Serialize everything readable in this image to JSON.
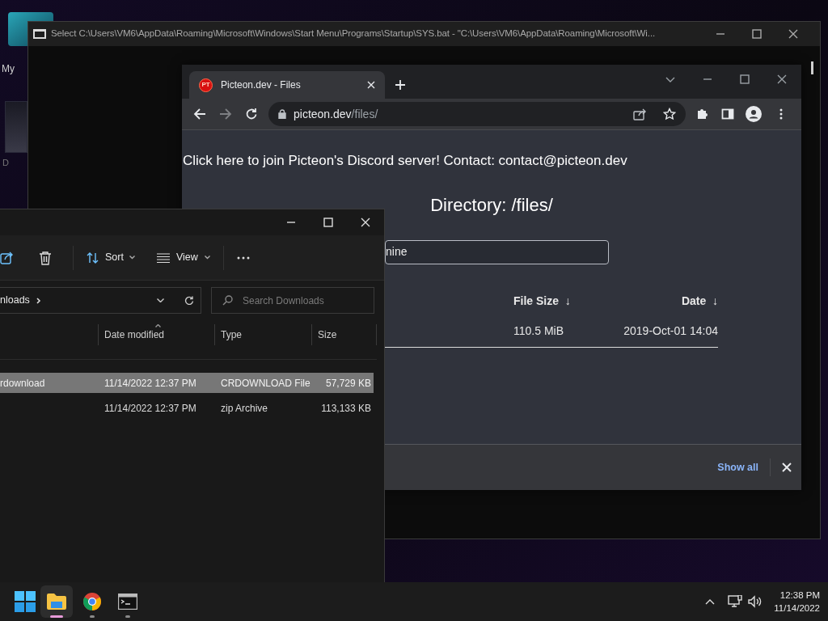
{
  "desktop": {
    "icons": [
      {
        "label": "My"
      },
      {
        "label": "D"
      }
    ]
  },
  "console_window": {
    "title": "Select C:\\Users\\VM6\\AppData\\Roaming\\Microsoft\\Windows\\Start Menu\\Programs\\Startup\\SYS.bat - \"C:\\Users\\VM6\\AppData\\Roaming\\Microsoft\\Wi..."
  },
  "browser": {
    "tabs": [
      {
        "title": "Picteon.dev - Files",
        "favicon_text": "PT",
        "selected": true
      }
    ],
    "address": {
      "host": "picteon.dev",
      "path": "/files/"
    },
    "page": {
      "notice": "Click here to join Picteon's Discord server! Contact: contact@picteon.dev",
      "heading": "Directory: /files/",
      "filter": {
        "value": "nine"
      },
      "table": {
        "columns": [
          {
            "label": "File Size",
            "sort_mark": "↓"
          },
          {
            "label": "Date",
            "sort_mark": "↓"
          }
        ],
        "rows": [
          {
            "cells": [
              "110.5 MiB",
              "2019-Oct-01 14:04"
            ]
          }
        ]
      }
    },
    "download_bar": {
      "show_all": "Show all"
    }
  },
  "explorer": {
    "toolbar": [
      {
        "kind": "share"
      },
      {
        "kind": "delete"
      },
      {
        "kind": "sort",
        "label": "Sort"
      },
      {
        "kind": "view",
        "label": "View"
      },
      {
        "kind": "more"
      }
    ],
    "address": "nloads",
    "search": {
      "placeholder": "Search Downloads"
    },
    "columns": [
      {
        "label": "Date modified"
      },
      {
        "label": "Type"
      },
      {
        "label": "Size"
      }
    ],
    "rows": [
      {
        "name": "rdownload",
        "date": "11/14/2022 12:37 PM",
        "type": "CRDOWNLOAD File",
        "size": "57,729 KB",
        "selected": true
      },
      {
        "date": "11/14/2022 12:37 PM",
        "type": "zip Archive",
        "size": "113,133 KB",
        "selected": false
      }
    ]
  },
  "taskbar": {
    "apps": [
      {
        "kind": "files",
        "active": true
      },
      {
        "kind": "browser",
        "active": false
      },
      {
        "kind": "terminal",
        "active": false
      }
    ],
    "time": "12:38 PM",
    "date": "11/14/2022"
  }
}
